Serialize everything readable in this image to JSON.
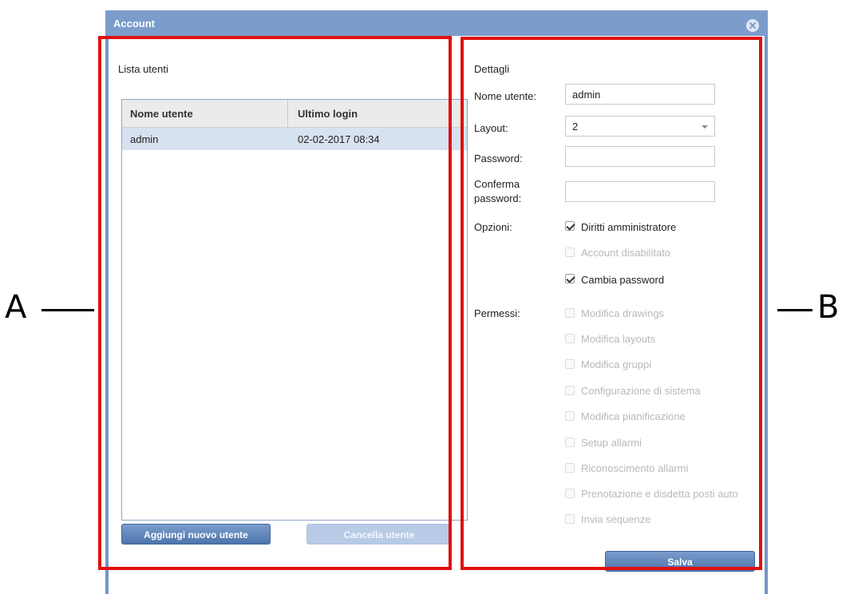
{
  "window": {
    "title": "Account",
    "close_icon": "close-circle-icon"
  },
  "user_list": {
    "caption": "Lista utenti",
    "columns": [
      "Nome utente",
      "Ultimo login"
    ],
    "rows": [
      {
        "username": "admin",
        "last_login": "02-02-2017 08:34"
      }
    ],
    "add_button": "Aggiungi nuovo utente",
    "delete_button": "Cancella utente"
  },
  "details": {
    "caption": "Dettagli",
    "username_label": "Nome utente:",
    "username_value": "admin",
    "layout_label": "Layout:",
    "layout_value": "2",
    "password_label": "Password:",
    "password_value": "",
    "confirm_label_1": "Conferma",
    "confirm_label_2": "password:",
    "confirm_value": "",
    "options_label": "Opzioni:",
    "options": [
      {
        "label": "Diritti amministratore",
        "checked": true,
        "enabled": true
      },
      {
        "label": "Account disabilitato",
        "checked": false,
        "enabled": false
      },
      {
        "label": "Cambia password",
        "checked": true,
        "enabled": true
      }
    ],
    "permissions_label": "Permessi:",
    "permissions": [
      {
        "label": "Modifica drawings",
        "checked": false,
        "enabled": false
      },
      {
        "label": "Modifica layouts",
        "checked": false,
        "enabled": false
      },
      {
        "label": "Modifica gruppi",
        "checked": false,
        "enabled": false
      },
      {
        "label": "Configurazione di sistema",
        "checked": false,
        "enabled": false
      },
      {
        "label": "Modifica pianificazione",
        "checked": false,
        "enabled": false
      },
      {
        "label": "Setup allarmi",
        "checked": false,
        "enabled": false
      },
      {
        "label": "Riconoscimento allarmi",
        "checked": false,
        "enabled": false
      },
      {
        "label": "Prenotazione e disdetta posti auto",
        "checked": false,
        "enabled": false
      },
      {
        "label": "Invia sequenze",
        "checked": false,
        "enabled": false
      }
    ],
    "save_button": "Salva"
  },
  "annotations": {
    "left_letter": "A",
    "right_letter": "B",
    "box_color": "#e01010"
  }
}
